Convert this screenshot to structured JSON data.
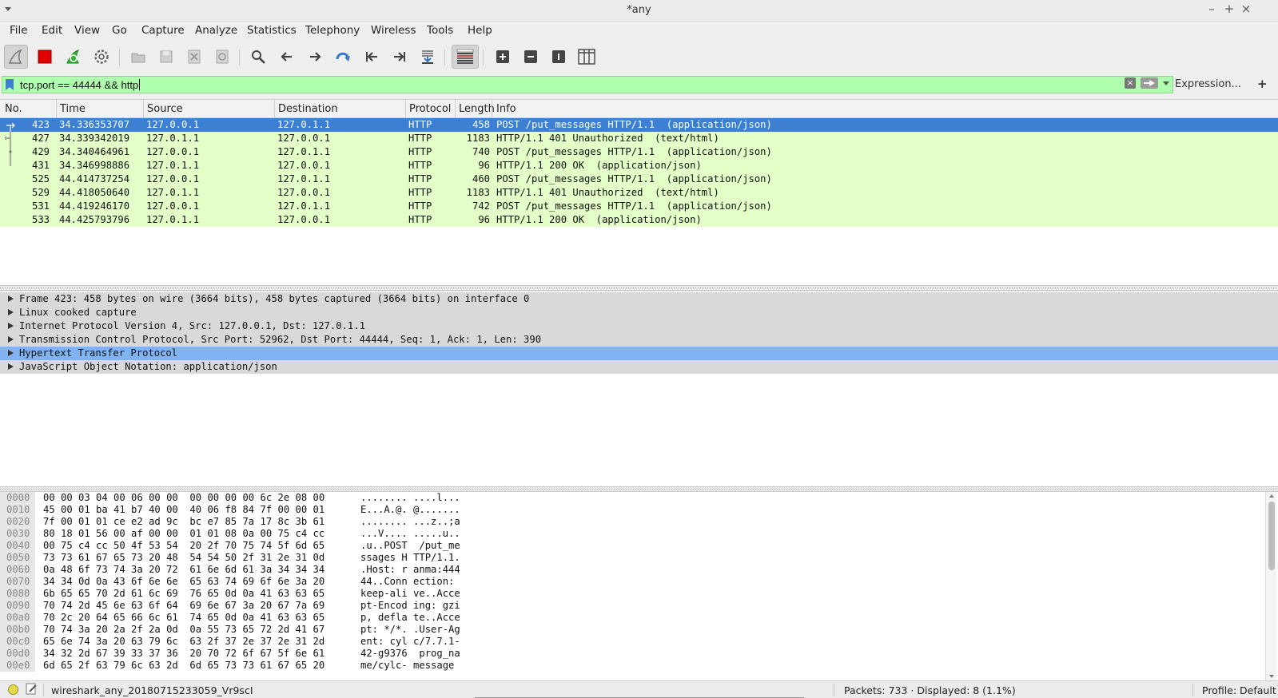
{
  "window": {
    "title": "*any",
    "controls": [
      "–",
      "+",
      "×"
    ]
  },
  "menu": [
    "File",
    "Edit",
    "View",
    "Go",
    "Capture",
    "Analyze",
    "Statistics",
    "Telephony",
    "Wireless",
    "Tools",
    "Help"
  ],
  "toolbar": {
    "icons": [
      "shark-fin-start-icon",
      "stop-capture-icon",
      "restart-capture-icon",
      "capture-options-icon",
      "open-file-icon",
      "save-file-icon",
      "close-file-icon",
      "reload-file-icon",
      "find-packet-icon",
      "go-back-icon",
      "go-forward-icon",
      "go-to-packet-icon",
      "first-packet-icon",
      "last-packet-icon",
      "autoscroll-icon",
      "colorize-icon",
      "zoom-in-icon",
      "zoom-out-icon",
      "normal-size-icon",
      "resize-columns-icon"
    ]
  },
  "filter": {
    "value": "tcp.port == 44444  && http",
    "expression_label": "Expression...",
    "add_label": "+",
    "clear_label": "×",
    "valid_color": "#afffaf"
  },
  "packet_list": {
    "columns": [
      "No.",
      "Time",
      "Source",
      "Destination",
      "Protocol",
      "Length",
      "Info"
    ],
    "selected_index": 0,
    "rows": [
      {
        "no": "423",
        "time": "34.336353707",
        "src": "127.0.0.1",
        "dst": "127.0.1.1",
        "proto": "HTTP",
        "len": "458",
        "info": "POST /put_messages HTTP/1.1  (application/json)"
      },
      {
        "no": "427",
        "time": "34.339342019",
        "src": "127.0.1.1",
        "dst": "127.0.0.1",
        "proto": "HTTP",
        "len": "1183",
        "info": "HTTP/1.1 401 Unauthorized  (text/html)"
      },
      {
        "no": "429",
        "time": "34.340464961",
        "src": "127.0.0.1",
        "dst": "127.0.1.1",
        "proto": "HTTP",
        "len": "740",
        "info": "POST /put_messages HTTP/1.1  (application/json)"
      },
      {
        "no": "431",
        "time": "34.346998886",
        "src": "127.0.1.1",
        "dst": "127.0.0.1",
        "proto": "HTTP",
        "len": "96",
        "info": "HTTP/1.1 200 OK  (application/json)"
      },
      {
        "no": "525",
        "time": "44.414737254",
        "src": "127.0.0.1",
        "dst": "127.0.1.1",
        "proto": "HTTP",
        "len": "460",
        "info": "POST /put_messages HTTP/1.1  (application/json)"
      },
      {
        "no": "529",
        "time": "44.418050640",
        "src": "127.0.1.1",
        "dst": "127.0.0.1",
        "proto": "HTTP",
        "len": "1183",
        "info": "HTTP/1.1 401 Unauthorized  (text/html)"
      },
      {
        "no": "531",
        "time": "44.419246170",
        "src": "127.0.0.1",
        "dst": "127.0.1.1",
        "proto": "HTTP",
        "len": "742",
        "info": "POST /put_messages HTTP/1.1  (application/json)"
      },
      {
        "no": "533",
        "time": "44.425793796",
        "src": "127.0.1.1",
        "dst": "127.0.0.1",
        "proto": "HTTP",
        "len": "96",
        "info": "HTTP/1.1 200 OK  (application/json)"
      }
    ],
    "row_color": "#e4ffc7",
    "selected_color": "#3c7fd3"
  },
  "details": {
    "selected_index": 4,
    "rows": [
      "Frame 423: 458 bytes on wire (3664 bits), 458 bytes captured (3664 bits) on interface 0",
      "Linux cooked capture",
      "Internet Protocol Version 4, Src: 127.0.0.1, Dst: 127.0.1.1",
      "Transmission Control Protocol, Src Port: 52962, Dst Port: 44444, Seq: 1, Ack: 1, Len: 390",
      "Hypertext Transfer Protocol",
      "JavaScript Object Notation: application/json"
    ]
  },
  "bytes": [
    {
      "off": "0000",
      "hex": "00 00 03 04 00 06 00 00  00 00 00 00 6c 2e 08 00",
      "ascii": "........ ....l..."
    },
    {
      "off": "0010",
      "hex": "45 00 01 ba 41 b7 40 00  40 06 f8 84 7f 00 00 01",
      "ascii": "E...A.@. @......."
    },
    {
      "off": "0020",
      "hex": "7f 00 01 01 ce e2 ad 9c  bc e7 85 7a 17 8c 3b 61",
      "ascii": "........ ...z..;a"
    },
    {
      "off": "0030",
      "hex": "80 18 01 56 00 af 00 00  01 01 08 0a 00 75 c4 cc",
      "ascii": "...V.... .....u.."
    },
    {
      "off": "0040",
      "hex": "00 75 c4 cc 50 4f 53 54  20 2f 70 75 74 5f 6d 65",
      "ascii": ".u..POST  /put_me"
    },
    {
      "off": "0050",
      "hex": "73 73 61 67 65 73 20 48  54 54 50 2f 31 2e 31 0d",
      "ascii": "ssages H TTP/1.1."
    },
    {
      "off": "0060",
      "hex": "0a 48 6f 73 74 3a 20 72  61 6e 6d 61 3a 34 34 34",
      "ascii": ".Host: r anma:444"
    },
    {
      "off": "0070",
      "hex": "34 34 0d 0a 43 6f 6e 6e  65 63 74 69 6f 6e 3a 20",
      "ascii": "44..Conn ection: "
    },
    {
      "off": "0080",
      "hex": "6b 65 65 70 2d 61 6c 69  76 65 0d 0a 41 63 63 65",
      "ascii": "keep-ali ve..Acce"
    },
    {
      "off": "0090",
      "hex": "70 74 2d 45 6e 63 6f 64  69 6e 67 3a 20 67 7a 69",
      "ascii": "pt-Encod ing: gzi"
    },
    {
      "off": "00a0",
      "hex": "70 2c 20 64 65 66 6c 61  74 65 0d 0a 41 63 63 65",
      "ascii": "p, defla te..Acce"
    },
    {
      "off": "00b0",
      "hex": "70 74 3a 20 2a 2f 2a 0d  0a 55 73 65 72 2d 41 67",
      "ascii": "pt: */*. .User-Ag"
    },
    {
      "off": "00c0",
      "hex": "65 6e 74 3a 20 63 79 6c  63 2f 37 2e 37 2e 31 2d",
      "ascii": "ent: cyl c/7.7.1-"
    },
    {
      "off": "00d0",
      "hex": "34 32 2d 67 39 33 37 36  20 70 72 6f 67 5f 6e 61",
      "ascii": "42-g9376  prog_na"
    },
    {
      "off": "00e0",
      "hex": "6d 65 2f 63 79 6c 63 2d  6d 65 73 73 61 67 65 20",
      "ascii": "me/cylc- message "
    }
  ],
  "status": {
    "file": "wireshark_any_20180715233059_Vr9scI",
    "stats": "Packets: 733 · Displayed: 8 (1.1%)",
    "profile": "Profile: Default"
  }
}
